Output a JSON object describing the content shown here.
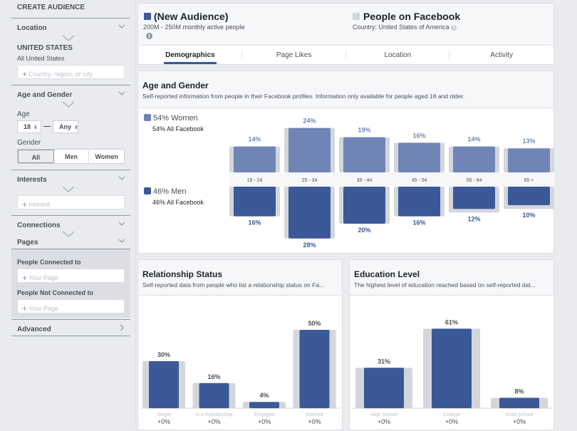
{
  "sidebar": {
    "title": "CREATE AUDIENCE",
    "location": {
      "label": "Location",
      "country": "UNITED STATES",
      "region": "All United States",
      "placeholder": "Country, region, or city"
    },
    "age_gender": {
      "label": "Age and Gender",
      "age_label": "Age",
      "age_min": "18",
      "age_max": "Any",
      "gender_label": "Gender",
      "gender_options": [
        "All",
        "Men",
        "Women"
      ],
      "gender_selected": "All"
    },
    "interests": {
      "label": "Interests",
      "placeholder": "Interest"
    },
    "connections": {
      "label": "Connections"
    },
    "pages": {
      "label": "Pages",
      "connected_label": "People Connected to",
      "connected_placeholder": "Your Page",
      "not_connected_label": "People Not Connected to",
      "not_connected_placeholder": "Your Page"
    },
    "advanced": {
      "label": "Advanced"
    }
  },
  "header": {
    "audience_name": "(New Audience)",
    "audience_size": "200M - 250M monthly active people",
    "comparison_name": "People on Facebook",
    "comparison_sub": "Country: United States of America",
    "colors": {
      "audience": "#3b5998",
      "comparison": "#d3d6db"
    }
  },
  "tabs": [
    {
      "label": "Demographics",
      "active": true
    },
    {
      "label": "Page Likes",
      "active": false
    },
    {
      "label": "Location",
      "active": false
    },
    {
      "label": "Activity",
      "active": false
    }
  ],
  "age_gender_card": {
    "title": "Age and Gender",
    "subtitle": "Self-reported information from people in their Facebook profiles. Information only available for people aged 18 and older.",
    "women_legend": "54% Women",
    "women_all": "54% All Facebook",
    "men_legend": "46% Men",
    "men_all": "46% All Facebook"
  },
  "relationship_card": {
    "title": "Relationship Status",
    "subtitle": "Self-reported data from people who list a relationship status on Fa..."
  },
  "education_card": {
    "title": "Education Level",
    "subtitle": "The highest level of education reached based on self-reported dat..."
  },
  "chart_data": [
    {
      "type": "bar",
      "title": "Age and Gender",
      "categories": [
        "18 - 24",
        "25 - 34",
        "35 - 44",
        "45 - 54",
        "55 - 64",
        "65 +"
      ],
      "series": [
        {
          "name": "Women",
          "values": [
            14,
            24,
            19,
            16,
            14,
            13
          ],
          "labels": [
            "14%",
            "24%",
            "19%",
            "16%",
            "14%",
            "13%"
          ],
          "color": "#7085b6"
        },
        {
          "name": "Men",
          "values": [
            16,
            28,
            20,
            16,
            12,
            10
          ],
          "labels": [
            "16%",
            "28%",
            "20%",
            "16%",
            "12%",
            "10%"
          ],
          "color": "#3b5998"
        }
      ],
      "background_series": {
        "name": "All Facebook",
        "women": [
          14,
          24,
          19,
          16,
          14,
          13
        ],
        "men": [
          16,
          28,
          20,
          16,
          14,
          12
        ],
        "color": "#d3d6db"
      }
    },
    {
      "type": "bar",
      "title": "Relationship Status",
      "categories": [
        "Single",
        "In a Relationship",
        "Engaged",
        "Married"
      ],
      "values": [
        30,
        16,
        4,
        50
      ],
      "labels": [
        "30%",
        "16%",
        "4%",
        "50%"
      ],
      "deltas": [
        "+0%",
        "+0%",
        "+0%",
        "+0%"
      ],
      "background_values": [
        30,
        16,
        4,
        50
      ]
    },
    {
      "type": "bar",
      "title": "Education Level",
      "categories": [
        "High School",
        "College",
        "Grad School"
      ],
      "values": [
        31,
        61,
        8
      ],
      "labels": [
        "31%",
        "61%",
        "8%"
      ],
      "deltas": [
        "+0%",
        "+0%",
        "+0%"
      ],
      "background_values": [
        31,
        61,
        8
      ]
    }
  ]
}
